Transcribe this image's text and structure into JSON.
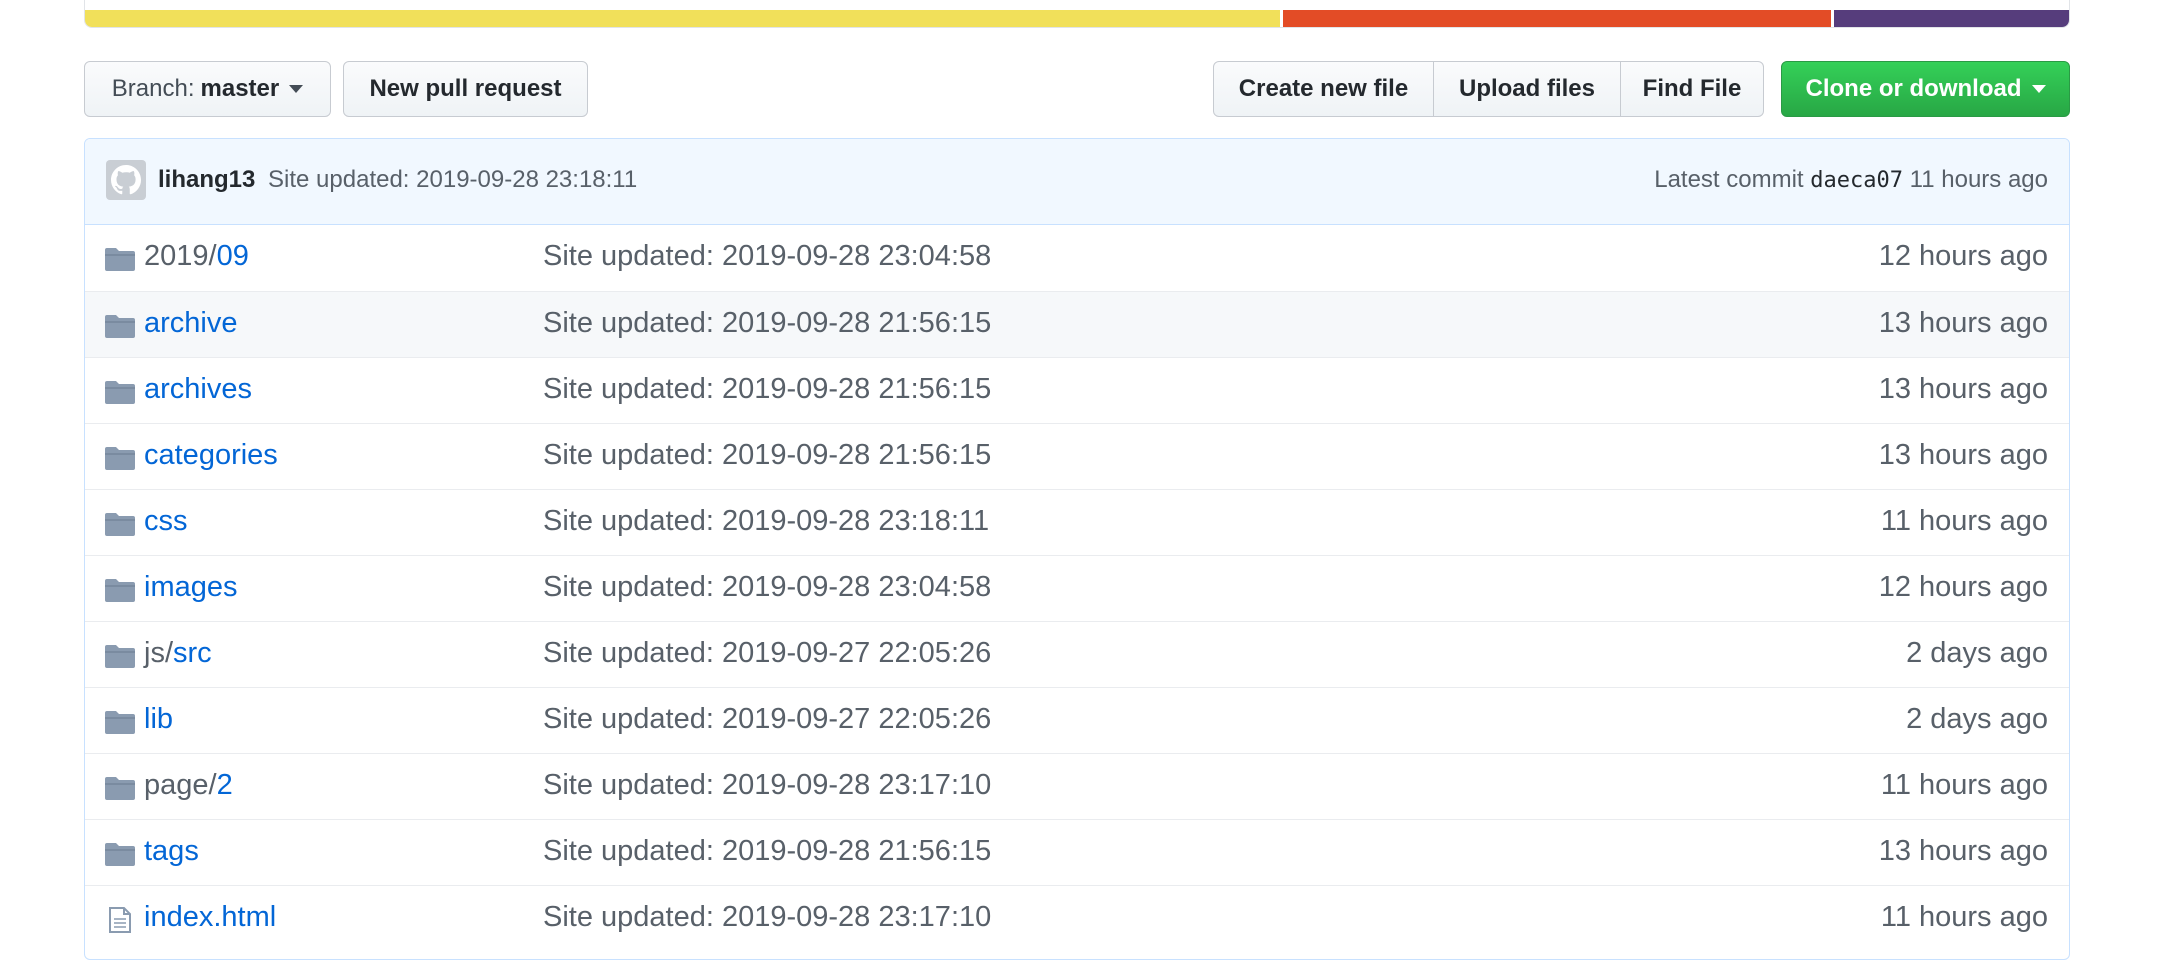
{
  "language_bar": {
    "segments": [
      {
        "color": "#f1e05a",
        "share": 0.604
      },
      {
        "color": "#e34c26",
        "share": 0.277
      },
      {
        "color": "#563d7c",
        "share": 0.119
      }
    ]
  },
  "toolbar": {
    "branch_prefix": "Branch:",
    "branch_name": "master",
    "new_pr": "New pull request",
    "create_file": "Create new file",
    "upload_files": "Upload files",
    "find_file": "Find File",
    "clone": "Clone or download"
  },
  "commit": {
    "author": "lihang13",
    "message": "Site updated: 2019-09-28 23:18:11",
    "latest_label": "Latest commit",
    "sha": "daeca07",
    "age": "11 hours ago"
  },
  "files": [
    {
      "type": "dir",
      "prefix": "2019/",
      "link": "09",
      "message": "Site updated: 2019-09-28 23:04:58",
      "age": "12 hours ago"
    },
    {
      "type": "dir",
      "prefix": "",
      "link": "archive",
      "message": "Site updated: 2019-09-28 21:56:15",
      "age": "13 hours ago"
    },
    {
      "type": "dir",
      "prefix": "",
      "link": "archives",
      "message": "Site updated: 2019-09-28 21:56:15",
      "age": "13 hours ago"
    },
    {
      "type": "dir",
      "prefix": "",
      "link": "categories",
      "message": "Site updated: 2019-09-28 21:56:15",
      "age": "13 hours ago"
    },
    {
      "type": "dir",
      "prefix": "",
      "link": "css",
      "message": "Site updated: 2019-09-28 23:18:11",
      "age": "11 hours ago"
    },
    {
      "type": "dir",
      "prefix": "",
      "link": "images",
      "message": "Site updated: 2019-09-28 23:04:58",
      "age": "12 hours ago"
    },
    {
      "type": "dir",
      "prefix": "js/",
      "link": "src",
      "message": "Site updated: 2019-09-27 22:05:26",
      "age": "2 days ago"
    },
    {
      "type": "dir",
      "prefix": "",
      "link": "lib",
      "message": "Site updated: 2019-09-27 22:05:26",
      "age": "2 days ago"
    },
    {
      "type": "dir",
      "prefix": "page/",
      "link": "2",
      "message": "Site updated: 2019-09-28 23:17:10",
      "age": "11 hours ago"
    },
    {
      "type": "dir",
      "prefix": "",
      "link": "tags",
      "message": "Site updated: 2019-09-28 21:56:15",
      "age": "13 hours ago"
    },
    {
      "type": "file",
      "prefix": "",
      "link": "index.html",
      "message": "Site updated: 2019-09-28 23:17:10",
      "age": "11 hours ago"
    }
  ]
}
